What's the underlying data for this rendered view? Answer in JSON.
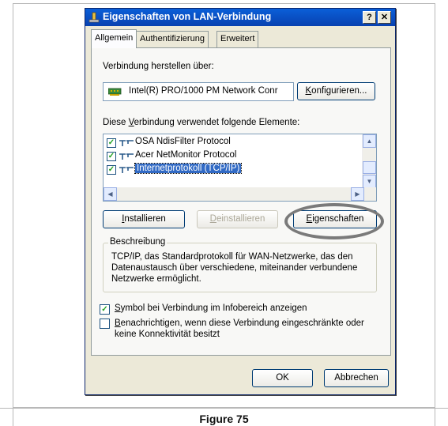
{
  "window": {
    "title": "Eigenschaften von LAN-Verbindung",
    "help_button": "?",
    "close_button": "✕"
  },
  "tabs": [
    {
      "label": "Allgemein",
      "active": true
    },
    {
      "label": "Authentifizierung",
      "active": false
    },
    {
      "label": "Erweitert",
      "active": false
    }
  ],
  "general": {
    "connect_using_label": "Verbindung herstellen über:",
    "adapter_name": "Intel(R) PRO/1000 PM Network Conr",
    "configure_button": "Konfigurieren...",
    "components_label_pre": "Diese ",
    "components_label_key": "V",
    "components_label_post": "erbindung verwendet folgende Elemente:",
    "components": [
      {
        "label": "OSA NdisFilter Protocol",
        "checked": true,
        "selected": false
      },
      {
        "label": "Acer NetMonitor Protocol",
        "checked": true,
        "selected": false
      },
      {
        "label": "Internetprotokoll (TCP/IP)",
        "checked": true,
        "selected": true
      }
    ],
    "install_button": "Installieren",
    "uninstall_button": "Deinstallieren",
    "properties_button": "Eigenschaften",
    "description_title": "Beschreibung",
    "description_text": "TCP/IP, das Standardprotokoll für WAN-Netzwerke, das den Datenaustausch über verschiedene, miteinander verbundene Netzwerke ermöglicht.",
    "show_icon_option": "Symbol bei Verbindung im Infobereich anzeigen",
    "notify_option": "Benachrichtigen, wenn diese Verbindung eingeschränkte oder keine Konnektivität besitzt",
    "show_icon_checked": true,
    "notify_checked": false
  },
  "footer": {
    "ok_button": "OK",
    "cancel_button": "Abbrechen"
  },
  "figure_caption": "Figure 75",
  "colors": {
    "titlebar": "#0a5fd8",
    "selection": "#316ac5",
    "highlight_ellipse": "#7a7a7a"
  }
}
